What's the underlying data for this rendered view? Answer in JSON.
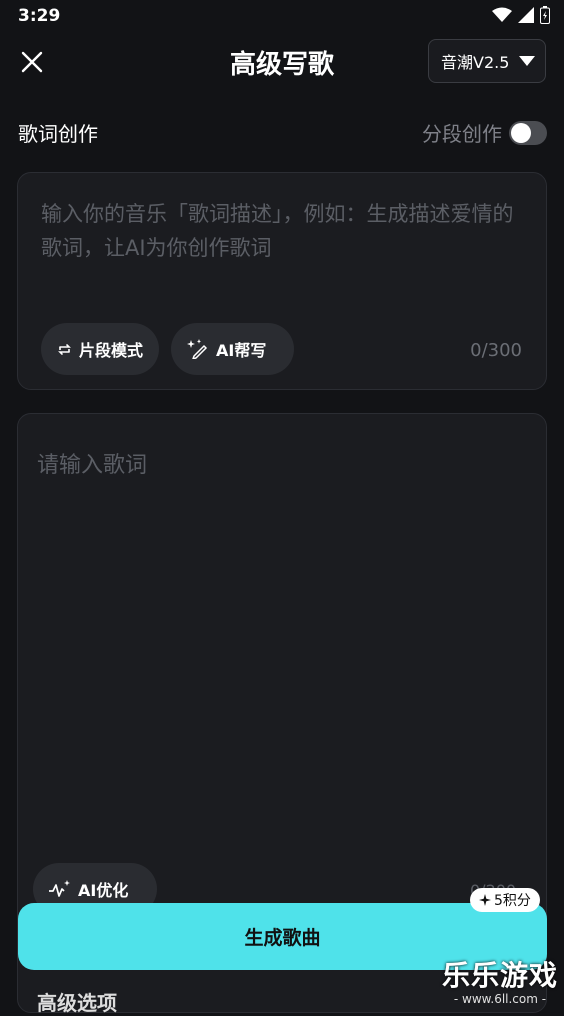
{
  "status": {
    "time": "3:29"
  },
  "header": {
    "title": "高级写歌",
    "model": "音潮V2.5"
  },
  "lyrics_section": {
    "label": "歌词创作",
    "segment_label": "分段创作",
    "segment_enabled": false
  },
  "description": {
    "placeholder": "输入你的音乐「歌词描述」，例如：生成描述爱情的歌词，让AI为你创作歌词",
    "segment_mode_label": "片段模式",
    "ai_write_label": "AI帮写",
    "counter": "0/300"
  },
  "lyrics": {
    "placeholder": "请输入歌词",
    "optimize_label": "AI优化",
    "counter": "0/200"
  },
  "advanced": {
    "label": "高级选项"
  },
  "generate": {
    "label": "生成歌曲",
    "cost": "5积分"
  },
  "watermark": {
    "main": "乐乐游戏",
    "sub": "- www.6ll.com -"
  },
  "colors": {
    "accent": "#4fe2ea",
    "background": "#121316",
    "card": "#1b1c20"
  },
  "icons": [
    "wifi-icon",
    "signal-icon",
    "battery-icon",
    "close-icon",
    "dropdown-icon",
    "repeat-icon",
    "magic-pen-icon",
    "sparkle-wave-icon",
    "star-icon"
  ]
}
